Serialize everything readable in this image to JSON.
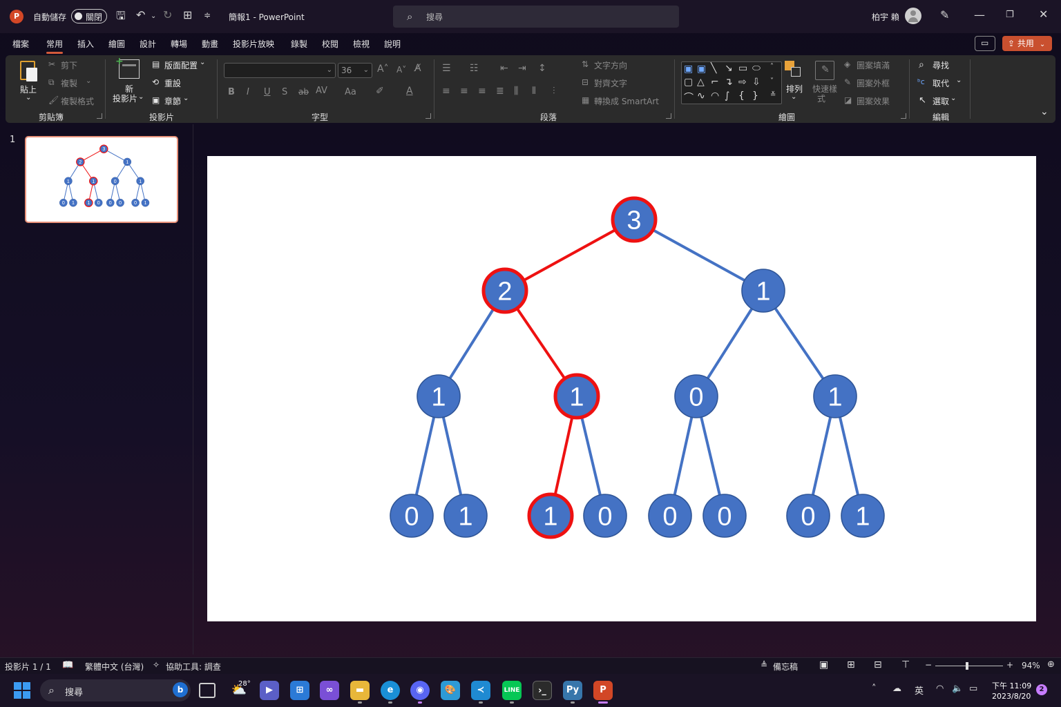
{
  "titlebar": {
    "autosave_label": "自動儲存",
    "autosave_state": "關閉",
    "doc_title": "簡報1  -  PowerPoint",
    "search_placeholder": "搜尋",
    "user_name": "柏宇 賴"
  },
  "menu": {
    "tabs": [
      "檔案",
      "常用",
      "插入",
      "繪圖",
      "設計",
      "轉場",
      "動畫",
      "投影片放映",
      "錄製",
      "校閱",
      "檢視",
      "說明"
    ],
    "active": "常用",
    "share_label": "共用"
  },
  "ribbon": {
    "clipboard": {
      "label": "剪貼簿",
      "paste": "貼上",
      "cut": "剪下",
      "copy": "複製",
      "format_painter": "複製格式"
    },
    "slides": {
      "label": "投影片",
      "new_slide_1": "新",
      "new_slide_2": "投影片",
      "layout": "版面配置",
      "reset": "重設",
      "section": "章節"
    },
    "font": {
      "label": "字型",
      "font_name": "",
      "font_size": "36"
    },
    "paragraph": {
      "label": "段落",
      "text_direction": "文字方向",
      "align_text": "對齊文字",
      "convert_smartart": "轉換成 SmartArt"
    },
    "drawing": {
      "label": "繪圖",
      "arrange": "排列",
      "quick_styles_1": "快速樣",
      "quick_styles_2": "式",
      "shape_fill": "圖案填滿",
      "shape_outline": "圖案外框",
      "shape_effects": "圖案效果"
    },
    "editing": {
      "label": "編輯",
      "find": "尋找",
      "replace": "取代",
      "select": "選取"
    }
  },
  "thumbnail": {
    "slide_number": "1"
  },
  "tree": {
    "node_fill": "#4472c4",
    "node_stroke": "#2f5597",
    "highlight_color": "#ee1111",
    "edge_color": "#4472c4",
    "nodes": [
      {
        "id": "n0",
        "value": "3",
        "highlight": true
      },
      {
        "id": "n1",
        "value": "2",
        "highlight": true
      },
      {
        "id": "n2",
        "value": "1",
        "highlight": false
      },
      {
        "id": "n3",
        "value": "1",
        "highlight": false
      },
      {
        "id": "n4",
        "value": "1",
        "highlight": true
      },
      {
        "id": "n5",
        "value": "0",
        "highlight": false
      },
      {
        "id": "n6",
        "value": "1",
        "highlight": false
      },
      {
        "id": "n7",
        "value": "0",
        "highlight": false
      },
      {
        "id": "n8",
        "value": "1",
        "highlight": false
      },
      {
        "id": "n9",
        "value": "1",
        "highlight": true
      },
      {
        "id": "n10",
        "value": "0",
        "highlight": false
      },
      {
        "id": "n11",
        "value": "0",
        "highlight": false
      },
      {
        "id": "n12",
        "value": "0",
        "highlight": false
      },
      {
        "id": "n13",
        "value": "0",
        "highlight": false
      },
      {
        "id": "n14",
        "value": "1",
        "highlight": false
      }
    ],
    "edges": [
      {
        "from": "n0",
        "to": "n1",
        "highlight": true
      },
      {
        "from": "n0",
        "to": "n2",
        "highlight": false
      },
      {
        "from": "n1",
        "to": "n3",
        "highlight": false
      },
      {
        "from": "n1",
        "to": "n4",
        "highlight": true
      },
      {
        "from": "n2",
        "to": "n5",
        "highlight": false
      },
      {
        "from": "n2",
        "to": "n6",
        "highlight": false
      },
      {
        "from": "n3",
        "to": "n7",
        "highlight": false
      },
      {
        "from": "n3",
        "to": "n8",
        "highlight": false
      },
      {
        "from": "n4",
        "to": "n9",
        "highlight": true
      },
      {
        "from": "n4",
        "to": "n10",
        "highlight": false
      },
      {
        "from": "n5",
        "to": "n11",
        "highlight": false
      },
      {
        "from": "n5",
        "to": "n12",
        "highlight": false
      },
      {
        "from": "n6",
        "to": "n13",
        "highlight": false
      },
      {
        "from": "n6",
        "to": "n14",
        "highlight": false
      }
    ]
  },
  "statusbar": {
    "slide_info": "投影片 1 / 1",
    "language": "繁體中文 (台灣)",
    "accessibility": "協助工具: 調查",
    "notes": "備忘稿",
    "zoom": "94%"
  },
  "taskbar": {
    "search_placeholder": "搜尋",
    "weather": "28°",
    "ime": "英",
    "time": "下午 11:09",
    "date": "2023/8/20",
    "notifications": "2"
  }
}
